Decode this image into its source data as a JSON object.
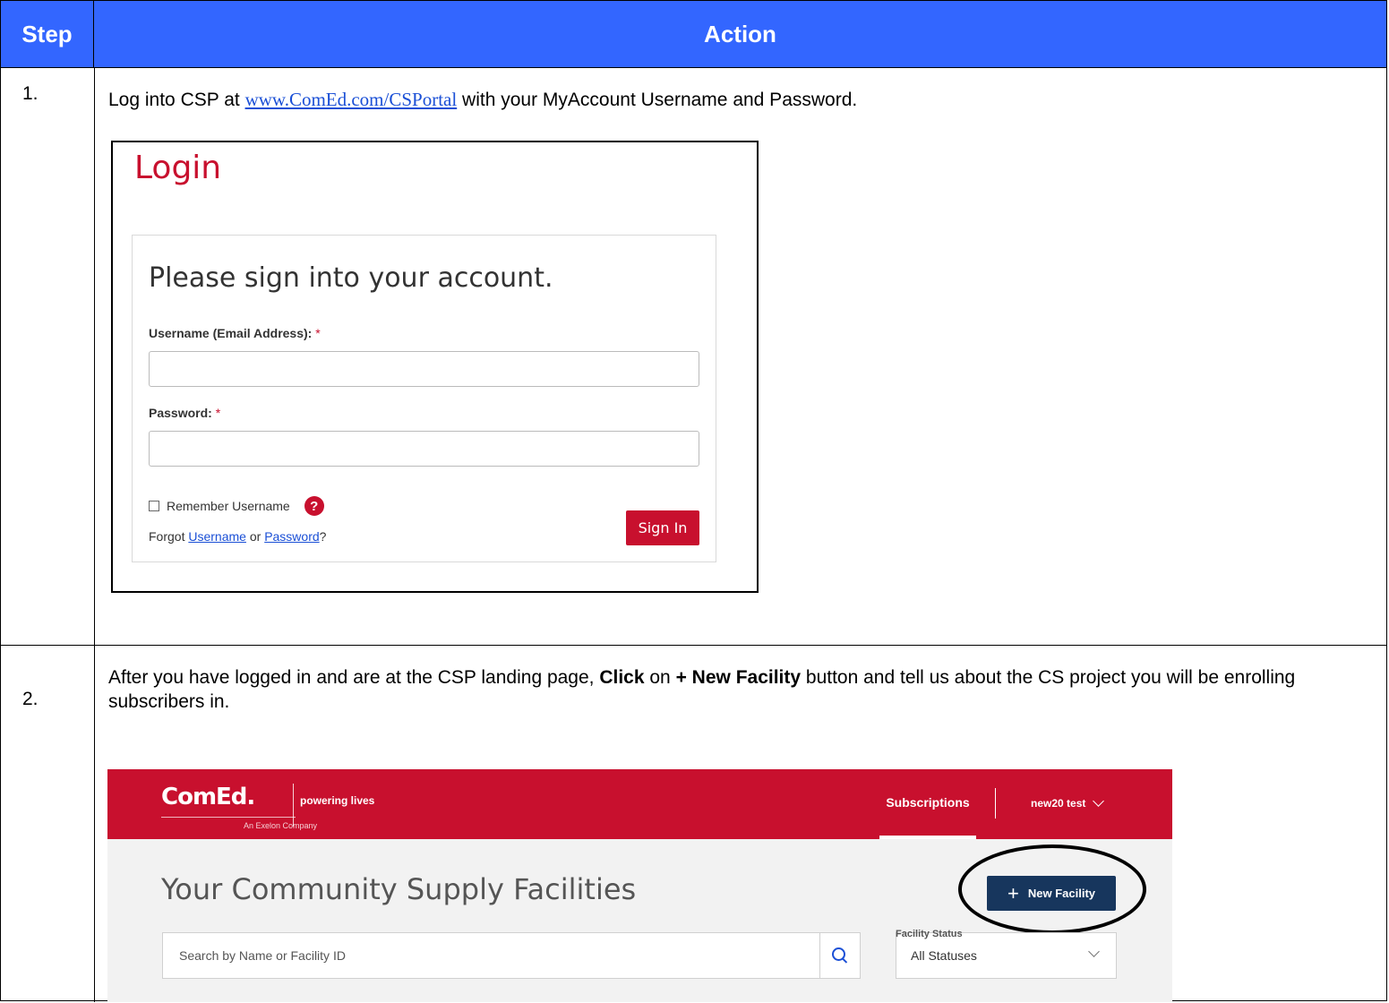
{
  "header": {
    "step": "Step",
    "action": "Action"
  },
  "step1": {
    "number": "1.",
    "text_before": "Log into CSP at ",
    "link": "www.ComEd.com/CSPortal",
    "text_after": " with your MyAccount Username and Password.",
    "login": {
      "title": "Login",
      "card_heading": "Please sign into your account.",
      "username_label": "Username (Email Address):",
      "password_label": "Password:",
      "required_mark": "*",
      "remember_label": "Remember Username",
      "help_glyph": "?",
      "forgot_prefix": "Forgot ",
      "forgot_username": "Username",
      "forgot_or": " or ",
      "forgot_password": "Password",
      "forgot_suffix": "?",
      "sign_in": "Sign In"
    }
  },
  "step2": {
    "number": "2.",
    "text_1": "After you have logged in and are at the CSP landing page, ",
    "bold_1": "Click",
    "text_2": " on ",
    "bold_2": "+ New Facility",
    "text_3": " button and tell us about the CS project you will be enrolling subscribers in.",
    "csp": {
      "logo": "ComEd.",
      "logo_sub": "An Exelon Company",
      "tagline": "powering lives",
      "nav_subscriptions": "Subscriptions",
      "nav_user": "new20 test",
      "page_title": "Your Community Supply Facilities",
      "new_facility": "New Facility",
      "search_placeholder": "Search by Name or Facility ID",
      "status_label": "Facility Status",
      "status_value": "All Statuses"
    }
  },
  "colors": {
    "header_blue": "#3366ff",
    "comed_red": "#c8102e",
    "navy": "#17365d"
  },
  "icons": [
    "help-icon",
    "search-icon",
    "chevron-down-icon",
    "plus-icon",
    "checkbox-icon"
  ]
}
